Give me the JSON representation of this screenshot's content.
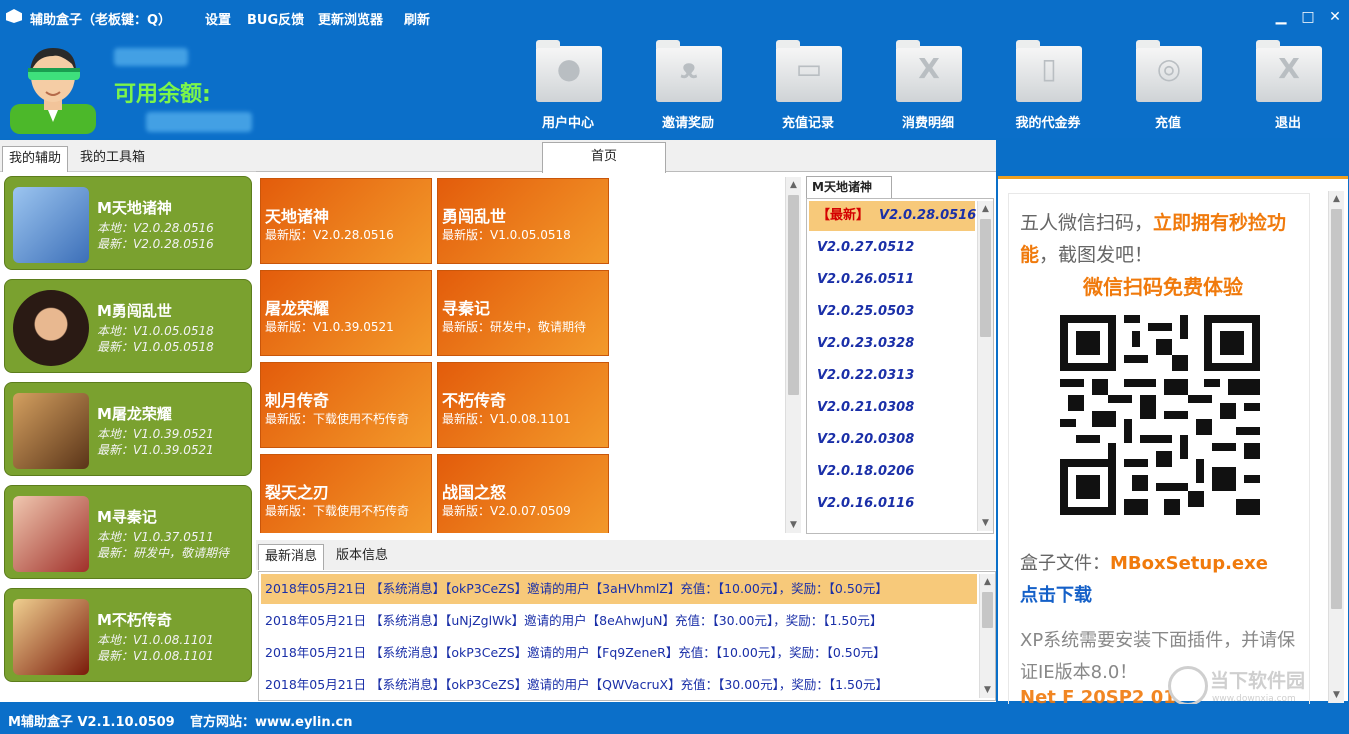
{
  "titlebar": {
    "title": "辅助盒子（老板键：Q）",
    "menu": [
      "设置",
      "BUG反馈",
      "更新浏览器",
      "刷新"
    ]
  },
  "header": {
    "balance_label": "可用余额:",
    "tools": [
      {
        "label": "用户中心",
        "icon": "user-icon"
      },
      {
        "label": "邀请奖励",
        "icon": "people-icon"
      },
      {
        "label": "充值记录",
        "icon": "record-icon"
      },
      {
        "label": "消费明细",
        "icon": "x-icon"
      },
      {
        "label": "我的代金券",
        "icon": "document-icon"
      },
      {
        "label": "充值",
        "icon": "compass-icon"
      },
      {
        "label": "退出",
        "icon": "x-icon"
      }
    ]
  },
  "left": {
    "tabs": [
      "我的辅助",
      "我的工具箱"
    ],
    "games": [
      {
        "name": "M天地诸神",
        "local": "本地：V2.0.28.0516",
        "latest": "最新：V2.0.28.0516",
        "color": "#6b9bd8"
      },
      {
        "name": "M勇闯乱世",
        "local": "本地：V1.0.05.0518",
        "latest": "最新：V1.0.05.0518",
        "color": "#3a2a22"
      },
      {
        "name": "M屠龙荣耀",
        "local": "本地：V1.0.39.0521",
        "latest": "最新：V1.0.39.0521",
        "color": "#8a5a2a"
      },
      {
        "name": "M寻秦记",
        "local": "本地：V1.0.37.0511",
        "latest": "最新：研发中，敬请期待",
        "color": "#a0403a"
      },
      {
        "name": "M不朽传奇",
        "local": "本地：V1.0.08.1101",
        "latest": "最新：V1.0.08.1101",
        "color": "#5a1a10"
      }
    ]
  },
  "main": {
    "tab": "首页",
    "tiles": [
      {
        "name": "天地诸神",
        "ver": "最新版：V2.0.28.0516"
      },
      {
        "name": "勇闯乱世",
        "ver": "最新版：V1.0.05.0518"
      },
      {
        "name": "屠龙荣耀",
        "ver": "最新版：V1.0.39.0521"
      },
      {
        "name": "寻秦记",
        "ver": "最新版：研发中，敬请期待"
      },
      {
        "name": "刺月传奇",
        "ver": "最新版：下载使用不朽传奇"
      },
      {
        "name": "不朽传奇",
        "ver": "最新版：V1.0.08.1101"
      },
      {
        "name": "裂天之刃",
        "ver": "最新版：下载使用不朽传奇"
      },
      {
        "name": "战国之怒",
        "ver": "最新版：V2.0.07.0509"
      }
    ]
  },
  "versions": {
    "tab": "M天地诸神",
    "new_tag": "【最新】",
    "items": [
      "V2.0.28.0516",
      "V2.0.27.0512",
      "V2.0.26.0511",
      "V2.0.25.0503",
      "V2.0.23.0328",
      "V2.0.22.0313",
      "V2.0.21.0308",
      "V2.0.20.0308",
      "V2.0.18.0206",
      "V2.0.16.0116"
    ]
  },
  "news": {
    "tabs": [
      "最新消息",
      "版本信息"
    ],
    "rows": [
      {
        "date": "2018年05月21日",
        "text": "【系统消息】【okP3CeZS】邀请的用户【3aHVhmlZ】充值：【10.00元】，奖励：【0.50元】"
      },
      {
        "date": "2018年05月21日",
        "text": "【系统消息】【uNjZglWk】邀请的用户【8eAhwJuN】充值：【30.00元】，奖励：【1.50元】"
      },
      {
        "date": "2018年05月21日",
        "text": "【系统消息】【okP3CeZS】邀请的用户【Fq9ZeneR】充值：【10.00元】，奖励：【0.50元】"
      },
      {
        "date": "2018年05月21日",
        "text": "【系统消息】【okP3CeZS】邀请的用户【QWVacruX】充值：【30.00元】，奖励：【1.50元】"
      }
    ]
  },
  "ad": {
    "line1_a": "五人微信扫码，",
    "line1_b": "立即拥有秒捡功能",
    "line1_c": "，截图发吧！",
    "qr_title": "微信扫码免费体验",
    "file_label": "盒子文件：",
    "file_name": "MBoxSetup.exe",
    "download": "点击下载",
    "xp_note": "XP系统需要安装下面插件，并请保证IE版本8.0！",
    "cut_line": "Net F 20SP2 01"
  },
  "watermark": {
    "text": "当下软件园",
    "url": "www.downxia.com"
  },
  "status": {
    "version": "M辅助盒子 V2.1.10.0509",
    "site": "官方网站：www.eylin.cn"
  },
  "colors": {
    "chrome": "#0b6fc9",
    "card": "#7aa12f",
    "tile": "#e8650f",
    "highlight": "#f7c97a",
    "accent": "#f07a0c"
  }
}
